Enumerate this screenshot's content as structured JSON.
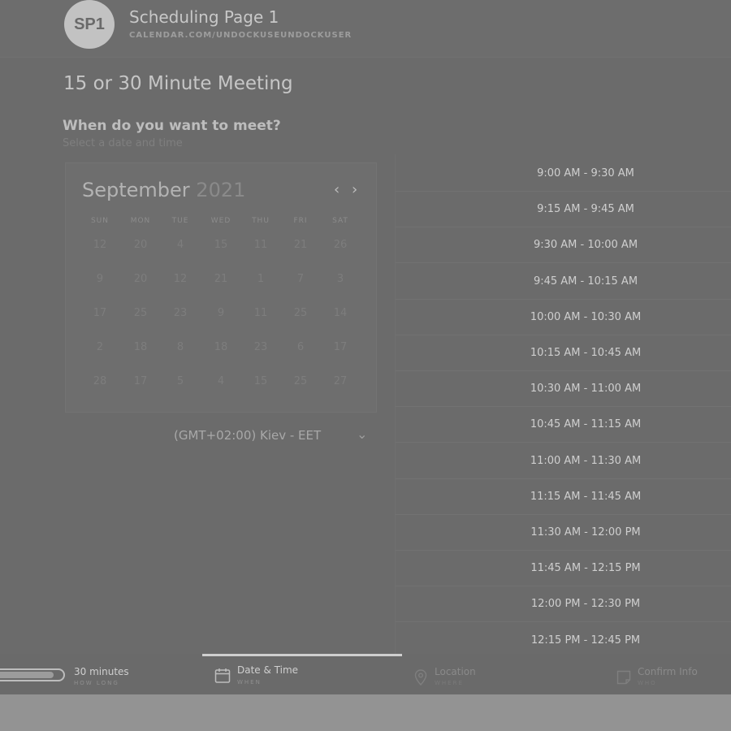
{
  "header": {
    "avatar_initials": "SP1",
    "page_name": "Scheduling Page 1",
    "page_url": "CALENDAR.COM/UNDOCKUSEUNDOCKUSER"
  },
  "meeting": {
    "title": "15 or 30 Minute Meeting",
    "question": "When do you want to meet?",
    "hint": "Select a date and time"
  },
  "calendar": {
    "month": "September",
    "year": "2021",
    "weekdays": [
      "SUN",
      "MON",
      "TUE",
      "WED",
      "THU",
      "FRI",
      "SAT"
    ],
    "weeks": [
      [
        "12",
        "20",
        "4",
        "15",
        "11",
        "21",
        "26"
      ],
      [
        "9",
        "20",
        "12",
        "21",
        "1",
        "7",
        "3"
      ],
      [
        "17",
        "25",
        "23",
        "9",
        "11",
        "25",
        "14"
      ],
      [
        "2",
        "18",
        "8",
        "18",
        "23",
        "6",
        "17"
      ],
      [
        "28",
        "17",
        "5",
        "4",
        "15",
        "25",
        "27"
      ]
    ]
  },
  "timezone": {
    "label": "(GMT+02:00) Kiev - EET"
  },
  "time_slots": [
    "9:00 AM - 9:30 AM",
    "9:15 AM - 9:45 AM",
    "9:30 AM - 10:00 AM",
    "9:45 AM - 10:15 AM",
    "10:00 AM - 10:30 AM",
    "10:15 AM - 10:45 AM",
    "10:30 AM - 11:00 AM",
    "10:45 AM - 11:15 AM",
    "11:00 AM - 11:30 AM",
    "11:15 AM - 11:45 AM",
    "11:30 AM - 12:00 PM",
    "11:45 AM - 12:15 PM",
    "12:00 PM - 12:30 PM",
    "12:15 PM - 12:45 PM"
  ],
  "footer": {
    "steps": [
      {
        "title": "30 minutes",
        "sub": "HOW LONG",
        "icon": "duration-pill-icon"
      },
      {
        "title": "Date & Time",
        "sub": "WHEN",
        "icon": "calendar-icon"
      },
      {
        "title": "Location",
        "sub": "WHERE",
        "icon": "location-pin-icon"
      },
      {
        "title": "Confirm Info",
        "sub": "WHO",
        "icon": "note-icon"
      }
    ],
    "duration_progress": 0.9
  },
  "colors": {
    "overlay_bg": "#6b6b6b",
    "bottom_band": "#939393",
    "active_step_line": "#cfcfcf"
  }
}
